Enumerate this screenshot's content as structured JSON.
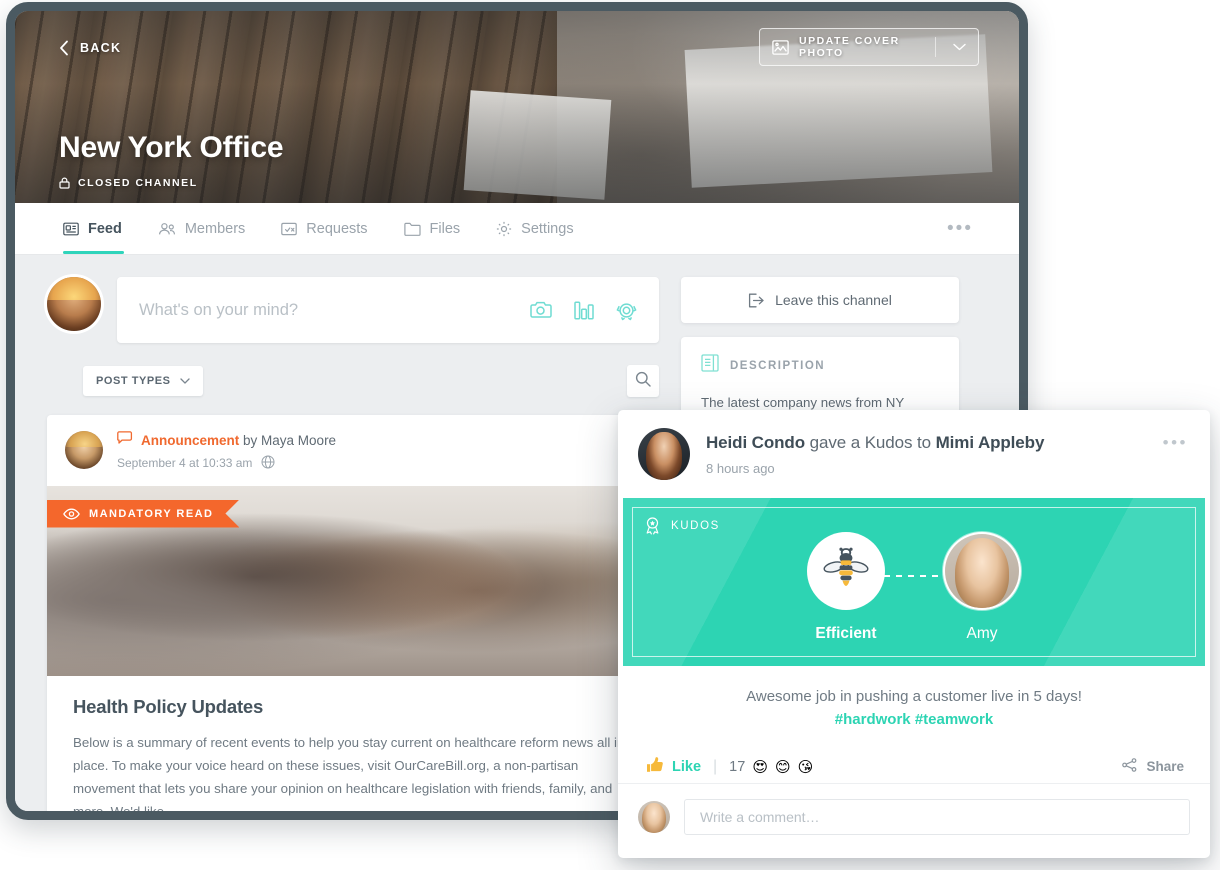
{
  "cover": {
    "back_label": "BACK",
    "title": "New York Office",
    "privacy_label": "CLOSED CHANNEL",
    "update_cover_label": "UPDATE COVER PHOTO"
  },
  "tabs": [
    {
      "label": "Feed",
      "icon": "feed-icon",
      "active": true
    },
    {
      "label": "Members",
      "icon": "members-icon",
      "active": false
    },
    {
      "label": "Requests",
      "icon": "requests-icon",
      "active": false
    },
    {
      "label": "Files",
      "icon": "folder-icon",
      "active": false
    },
    {
      "label": "Settings",
      "icon": "gear-icon",
      "active": false
    }
  ],
  "tab_overflow": "•••",
  "composer": {
    "placeholder": "What's on your mind?",
    "icons": [
      "camera-icon",
      "poll-icon",
      "kudos-icon"
    ]
  },
  "filters": {
    "post_types_label": "POST TYPES",
    "search_icon": "search-icon"
  },
  "post": {
    "type_label": "Announcement",
    "byline": "by Maya Moore",
    "timestamp": "September 4 at 10:33 am",
    "audience_icon": "globe-icon",
    "badge_label": "MANDATORY READ",
    "title": "Health Policy Updates",
    "text": "Below is a summary of recent events to help you stay current on healthcare reform news all in place. To make your voice heard on these issues, visit OurCareBill.org, a non-partisan movement that lets you share your opinion on healthcare legislation with friends, family, and more. We'd like"
  },
  "sidebar": {
    "leave_label": "Leave this channel",
    "description_heading": "DESCRIPTION",
    "description_text": "The latest company news from NY office."
  },
  "kudos": {
    "giver": "Heidi Condo",
    "middle_text": " gave a Kudos to ",
    "receiver": "Mimi Appleby",
    "time": "8 hours ago",
    "overflow": "•••",
    "banner_label": "KUDOS",
    "badge_name": "Efficient",
    "badge_icon": "bee-icon",
    "recipient_name": "Amy",
    "message": "Awesome job in pushing a customer live in 5 days!",
    "hashtags": "#hardwork #teamwork",
    "like_label": "Like",
    "like_icon": "thumbs-up-icon",
    "reaction_count": "17",
    "reactions": [
      "😍",
      "😊",
      "😘"
    ],
    "share_label": "Share",
    "comment_placeholder": "Write a comment…"
  },
  "colors": {
    "accent_teal": "#2dd4b3",
    "announcement_orange": "#f0692f",
    "mandatory_orange": "#f4672c",
    "frame": "#4b5a62",
    "text_dark": "#46545e",
    "text_muted": "#9aa3ab"
  }
}
